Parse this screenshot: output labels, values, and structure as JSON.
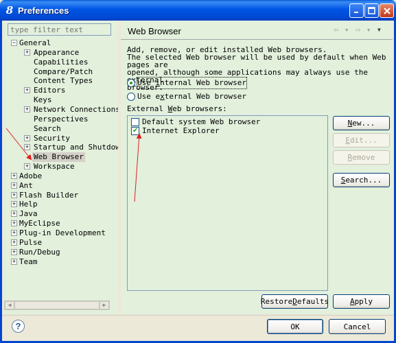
{
  "window": {
    "title": "Preferences",
    "app_icon": "8"
  },
  "sidebar": {
    "filter_placeholder": "type filter text",
    "items": [
      {
        "label": "General",
        "expanded": true,
        "level": 0
      },
      {
        "label": "Appearance",
        "level": 1
      },
      {
        "label": "Capabilities",
        "level": 1
      },
      {
        "label": "Compare/Patch",
        "level": 1
      },
      {
        "label": "Content Types",
        "level": 1
      },
      {
        "label": "Editors",
        "level": 1
      },
      {
        "label": "Keys",
        "level": 1
      },
      {
        "label": "Network Connections",
        "level": 1
      },
      {
        "label": "Perspectives",
        "level": 1
      },
      {
        "label": "Search",
        "level": 1
      },
      {
        "label": "Security",
        "level": 1
      },
      {
        "label": "Startup and Shutdown",
        "level": 1
      },
      {
        "label": "Web Browser",
        "level": 1,
        "selected": true
      },
      {
        "label": "Workspace",
        "level": 1
      },
      {
        "label": "Adobe",
        "level": 0
      },
      {
        "label": "Ant",
        "level": 0
      },
      {
        "label": "Flash Builder",
        "level": 0
      },
      {
        "label": "Help",
        "level": 0
      },
      {
        "label": "Java",
        "level": 0
      },
      {
        "label": "MyEclipse",
        "level": 0
      },
      {
        "label": "Plug-in Development",
        "level": 0
      },
      {
        "label": "Pulse",
        "level": 0
      },
      {
        "label": "Run/Debug",
        "level": 0
      },
      {
        "label": "Team",
        "level": 0
      }
    ]
  },
  "page": {
    "title": "Web Browser",
    "description": [
      "Add, remove, or edit installed Web browsers.",
      "The selected Web browser will be used by default when Web pages are",
      "opened, although some applications may always use the external",
      "browser."
    ],
    "radio_internal": "Use internal Web browser",
    "radio_external": "Use external Web browser",
    "selected_radio": "internal",
    "external_label": "External Web browsers:",
    "browsers": [
      {
        "label": "Default system Web browser",
        "checked": false
      },
      {
        "label": "Internet Explorer",
        "checked": true
      }
    ],
    "buttons": {
      "new": "New...",
      "edit": "Edit...",
      "remove": "Remove",
      "search": "Search..."
    },
    "restore_defaults": "Restore Defaults",
    "apply": "Apply"
  },
  "footer": {
    "help": "?",
    "ok": "OK",
    "cancel": "Cancel"
  },
  "colors": {
    "title_bar": "#0055E5",
    "panel_bg": "#E2F0DC",
    "annotation": "#E0201B"
  }
}
